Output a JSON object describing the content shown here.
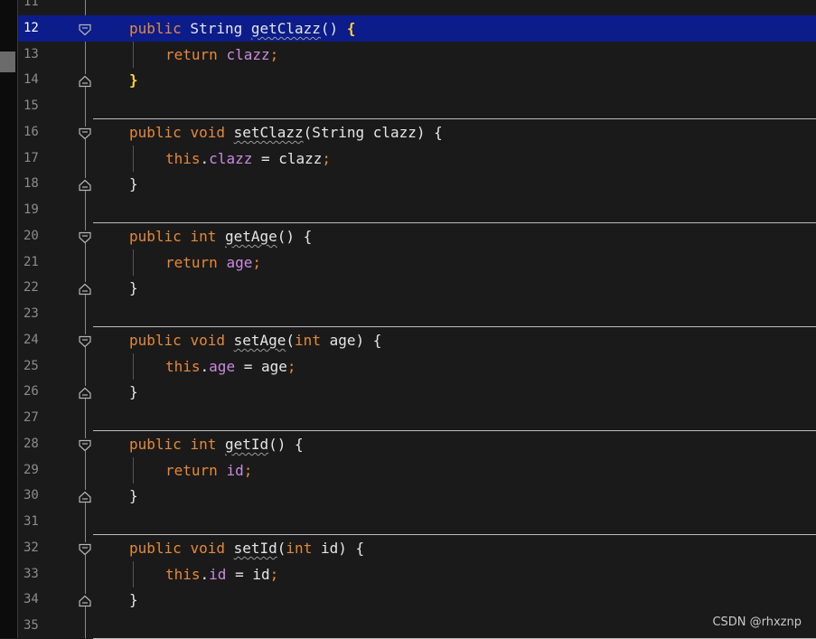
{
  "editor": {
    "current_line": 12,
    "colors": {
      "background": "#1a1a1a",
      "current_line_highlight": "#0c1c8a",
      "keyword": "#e4893a",
      "field": "#c98be0",
      "plain": "#e6e6e6",
      "line_number": "#8c8c8c",
      "matched_brace": "#ffd43b"
    },
    "lines": [
      {
        "n": "11",
        "tokens": [],
        "fold": null,
        "guide": false
      },
      {
        "n": "12",
        "indent": 1,
        "fold": "open",
        "tokens": [
          {
            "t": "public",
            "c": "kw"
          },
          {
            "t": " String "
          },
          {
            "t": "getClazz",
            "c": "meth"
          },
          {
            "t": "() "
          },
          {
            "t": "{",
            "c": "brace-hi"
          }
        ]
      },
      {
        "n": "13",
        "indent": 2,
        "fold": null,
        "guide": true,
        "tokens": [
          {
            "t": "return",
            "c": "kw"
          },
          {
            "t": " "
          },
          {
            "t": "clazz",
            "c": "fld"
          },
          {
            "t": ";",
            "c": "punc"
          }
        ]
      },
      {
        "n": "14",
        "indent": 1,
        "fold": "close",
        "tokens": [
          {
            "t": "}",
            "c": "brace-hi"
          }
        ]
      },
      {
        "n": "15",
        "tokens": [],
        "fold": null,
        "separator": true
      },
      {
        "n": "16",
        "indent": 1,
        "fold": "open",
        "tokens": [
          {
            "t": "public",
            "c": "kw"
          },
          {
            "t": " "
          },
          {
            "t": "void",
            "c": "kw"
          },
          {
            "t": " "
          },
          {
            "t": "setClazz",
            "c": "meth"
          },
          {
            "t": "(String clazz) {"
          }
        ]
      },
      {
        "n": "17",
        "indent": 2,
        "fold": null,
        "guide": true,
        "tokens": [
          {
            "t": "this",
            "c": "kw"
          },
          {
            "t": "."
          },
          {
            "t": "clazz",
            "c": "fld"
          },
          {
            "t": " = clazz"
          },
          {
            "t": ";",
            "c": "punc"
          }
        ]
      },
      {
        "n": "18",
        "indent": 1,
        "fold": "close",
        "tokens": [
          {
            "t": "}"
          }
        ]
      },
      {
        "n": "19",
        "tokens": [],
        "fold": null,
        "separator": true
      },
      {
        "n": "20",
        "indent": 1,
        "fold": "open",
        "tokens": [
          {
            "t": "public",
            "c": "kw"
          },
          {
            "t": " "
          },
          {
            "t": "int",
            "c": "kw"
          },
          {
            "t": " "
          },
          {
            "t": "getAge",
            "c": "meth"
          },
          {
            "t": "() {"
          }
        ]
      },
      {
        "n": "21",
        "indent": 2,
        "fold": null,
        "guide": true,
        "tokens": [
          {
            "t": "return",
            "c": "kw"
          },
          {
            "t": " "
          },
          {
            "t": "age",
            "c": "fld"
          },
          {
            "t": ";",
            "c": "punc"
          }
        ]
      },
      {
        "n": "22",
        "indent": 1,
        "fold": "close",
        "tokens": [
          {
            "t": "}"
          }
        ]
      },
      {
        "n": "23",
        "tokens": [],
        "fold": null,
        "separator": true
      },
      {
        "n": "24",
        "indent": 1,
        "fold": "open",
        "tokens": [
          {
            "t": "public",
            "c": "kw"
          },
          {
            "t": " "
          },
          {
            "t": "void",
            "c": "kw"
          },
          {
            "t": " "
          },
          {
            "t": "setAge",
            "c": "meth"
          },
          {
            "t": "("
          },
          {
            "t": "int",
            "c": "kw"
          },
          {
            "t": " age) {"
          }
        ]
      },
      {
        "n": "25",
        "indent": 2,
        "fold": null,
        "guide": true,
        "tokens": [
          {
            "t": "this",
            "c": "kw"
          },
          {
            "t": "."
          },
          {
            "t": "age",
            "c": "fld"
          },
          {
            "t": " = age"
          },
          {
            "t": ";",
            "c": "punc"
          }
        ]
      },
      {
        "n": "26",
        "indent": 1,
        "fold": "close",
        "tokens": [
          {
            "t": "}"
          }
        ]
      },
      {
        "n": "27",
        "tokens": [],
        "fold": null,
        "separator": true
      },
      {
        "n": "28",
        "indent": 1,
        "fold": "open",
        "tokens": [
          {
            "t": "public",
            "c": "kw"
          },
          {
            "t": " "
          },
          {
            "t": "int",
            "c": "kw"
          },
          {
            "t": " "
          },
          {
            "t": "getId",
            "c": "meth"
          },
          {
            "t": "() {"
          }
        ]
      },
      {
        "n": "29",
        "indent": 2,
        "fold": null,
        "guide": true,
        "tokens": [
          {
            "t": "return",
            "c": "kw"
          },
          {
            "t": " "
          },
          {
            "t": "id",
            "c": "fld"
          },
          {
            "t": ";",
            "c": "punc"
          }
        ]
      },
      {
        "n": "30",
        "indent": 1,
        "fold": "close",
        "tokens": [
          {
            "t": "}"
          }
        ]
      },
      {
        "n": "31",
        "tokens": [],
        "fold": null,
        "separator": true
      },
      {
        "n": "32",
        "indent": 1,
        "fold": "open",
        "tokens": [
          {
            "t": "public",
            "c": "kw"
          },
          {
            "t": " "
          },
          {
            "t": "void",
            "c": "kw"
          },
          {
            "t": " "
          },
          {
            "t": "setId",
            "c": "meth"
          },
          {
            "t": "("
          },
          {
            "t": "int",
            "c": "kw"
          },
          {
            "t": " id) {"
          }
        ]
      },
      {
        "n": "33",
        "indent": 2,
        "fold": null,
        "guide": true,
        "tokens": [
          {
            "t": "this",
            "c": "kw"
          },
          {
            "t": "."
          },
          {
            "t": "id",
            "c": "fld"
          },
          {
            "t": " = id"
          },
          {
            "t": ";",
            "c": "punc"
          }
        ]
      },
      {
        "n": "34",
        "indent": 1,
        "fold": "close",
        "tokens": [
          {
            "t": "}"
          }
        ]
      },
      {
        "n": "35",
        "tokens": [],
        "fold": null,
        "separator": true
      }
    ]
  },
  "watermark": "CSDN @rhxznp"
}
